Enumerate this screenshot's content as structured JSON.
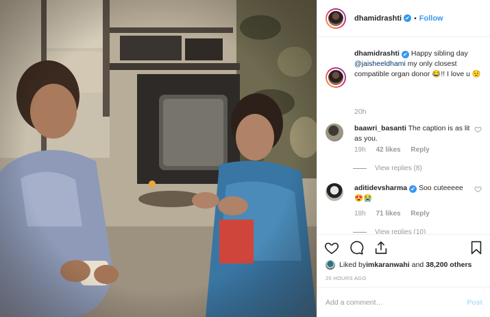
{
  "post": {
    "username": "dhamidrashti",
    "follow_label": "Follow",
    "dot": "•",
    "verified_icon": "✔"
  },
  "caption": {
    "username": "dhamidrashti",
    "text_before": " Happy sibling day ",
    "mention": "@jaisheeldhami",
    "text_after": " my only closest compatible organ donor 😂!! I love u 😟",
    "time": "20h"
  },
  "comments": [
    {
      "username": "baawri_basanti",
      "text": " The caption is as lit as you.",
      "time": "19h",
      "likes": "42 likes",
      "reply": "Reply",
      "view_replies": "View replies (8)"
    },
    {
      "username": "aditidevsharma",
      "text": " Soo cuteeeee 😍😭",
      "time": "18h",
      "likes": "71 likes",
      "reply": "Reply",
      "view_replies": "View replies (10)"
    }
  ],
  "likes": {
    "prefix": "Liked by ",
    "user": "imkaranwahi",
    "middle": " and ",
    "count": "38,200 others"
  },
  "timestamp": "20 HOURS AGO",
  "add_comment": {
    "placeholder": "Add a comment…",
    "post_label": "Post"
  },
  "colors": {
    "link": "#3897f0",
    "mention": "#003569",
    "muted": "#999999",
    "post_disabled": "#b2dffc"
  },
  "icons": [
    "heart-icon",
    "comment-icon",
    "share-icon",
    "bookmark-icon",
    "verified-icon"
  ]
}
